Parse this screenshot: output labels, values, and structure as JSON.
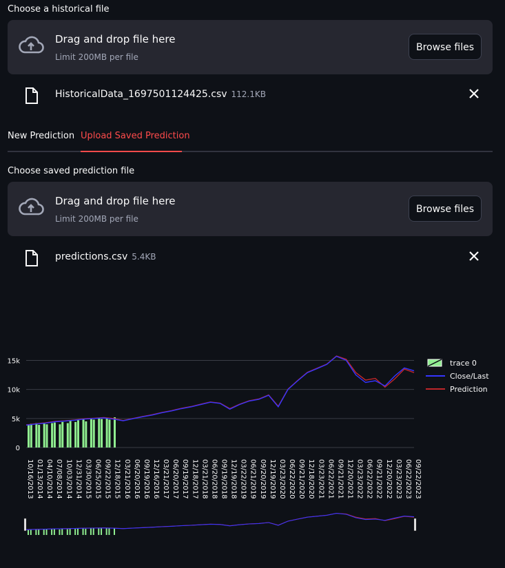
{
  "historical": {
    "label": "Choose a historical file",
    "dropzone_title": "Drag and drop file here",
    "dropzone_limit": "Limit 200MB per file",
    "browse_label": "Browse files",
    "file_name": "HistoricalData_1697501124425.csv",
    "file_size": "112.1KB"
  },
  "tabs": [
    {
      "label": "New Prediction",
      "active": false
    },
    {
      "label": "Upload Saved Prediction",
      "active": true
    }
  ],
  "saved": {
    "label": "Choose saved prediction file",
    "dropzone_title": "Drag and drop file here",
    "dropzone_limit": "Limit 200MB per file",
    "browse_label": "Browse files",
    "file_name": "predictions.csv",
    "file_size": "5.4KB"
  },
  "colors": {
    "accent": "#ff4b4b",
    "close_last": "#3535ff",
    "prediction": "#c0262a",
    "trace0": "#90ee90"
  },
  "chart_data": {
    "type": "line",
    "title": "",
    "xlabel": "",
    "ylabel": "",
    "ylim": [
      0,
      16000
    ],
    "y_ticks": [
      "0",
      "5k",
      "10k",
      "15k"
    ],
    "y_tick_values": [
      0,
      5000,
      10000,
      15000
    ],
    "x_tick_labels": [
      "10/16/2013",
      "01/13/2014",
      "04/10/2014",
      "07/08/2014",
      "10/03/2014",
      "12/31/2014",
      "03/30/2015",
      "06/25/2015",
      "09/22/2015",
      "12/18/2015",
      "03/21/2016",
      "06/20/2016",
      "09/19/2016",
      "12/16/2016",
      "03/21/2017",
      "06/20/2017",
      "09/19/2017",
      "12/18/2017",
      "03/21/2018",
      "06/20/2018",
      "09/19/2018",
      "12/19/2018",
      "03/22/2019",
      "06/21/2019",
      "09/20/2019",
      "12/19/2019",
      "03/23/2020",
      "06/22/2020",
      "09/21/2020",
      "12/18/2020",
      "03/23/2021",
      "06/22/2021",
      "09/21/2021",
      "12/20/2021",
      "03/23/2022",
      "06/22/2022",
      "09/21/2022",
      "12/20/2022",
      "03/23/2023",
      "06/22/2023",
      "09/22/2023"
    ],
    "legend": {
      "position": "top-right",
      "entries": [
        "trace 0",
        "Close/Last",
        "Prediction"
      ]
    },
    "grid": true,
    "x": [
      0,
      1,
      2,
      3,
      4,
      5,
      6,
      7,
      8,
      9,
      10,
      11,
      12,
      13,
      14,
      15,
      16,
      17,
      18,
      19,
      20,
      21,
      22,
      23,
      24,
      25,
      26,
      27,
      28,
      29,
      30,
      31,
      32,
      33,
      34,
      35,
      36,
      37,
      38,
      39,
      40
    ],
    "series": [
      {
        "name": "Close/Last",
        "values": [
          3850,
          4050,
          4200,
          4450,
          4550,
          4700,
          4900,
          5000,
          5100,
          4900,
          4600,
          4950,
          5300,
          5600,
          6000,
          6300,
          6700,
          7000,
          7400,
          7800,
          7600,
          6600,
          7400,
          8000,
          8300,
          9000,
          7000,
          10000,
          11500,
          12900,
          13600,
          14300,
          15700,
          15000,
          12500,
          11200,
          11500,
          10600,
          12300,
          13700,
          13200
        ]
      },
      {
        "name": "Prediction",
        "values": [
          3900,
          4100,
          4250,
          4500,
          4600,
          4750,
          4950,
          5050,
          5150,
          5000,
          4650,
          5000,
          5350,
          5650,
          6050,
          6350,
          6750,
          7050,
          7450,
          7850,
          7650,
          6700,
          7450,
          8050,
          8350,
          9050,
          7100,
          10050,
          11550,
          12950,
          13650,
          14350,
          15750,
          15200,
          12900,
          11600,
          11900,
          10400,
          11800,
          13500,
          12900
        ]
      },
      {
        "name": "trace 0",
        "type": "bar",
        "values": [
          4000,
          4100,
          3800,
          4200,
          3900,
          4300,
          4100,
          4000,
          3900,
          4200,
          4300,
          4100,
          4000,
          4400,
          4300,
          4200,
          4600,
          4500,
          4400,
          4700,
          4600,
          4800,
          4500,
          4700,
          4900,
          4800,
          4600,
          5000,
          4900,
          4700,
          5100,
          4800,
          5000,
          5200
        ]
      }
    ]
  }
}
